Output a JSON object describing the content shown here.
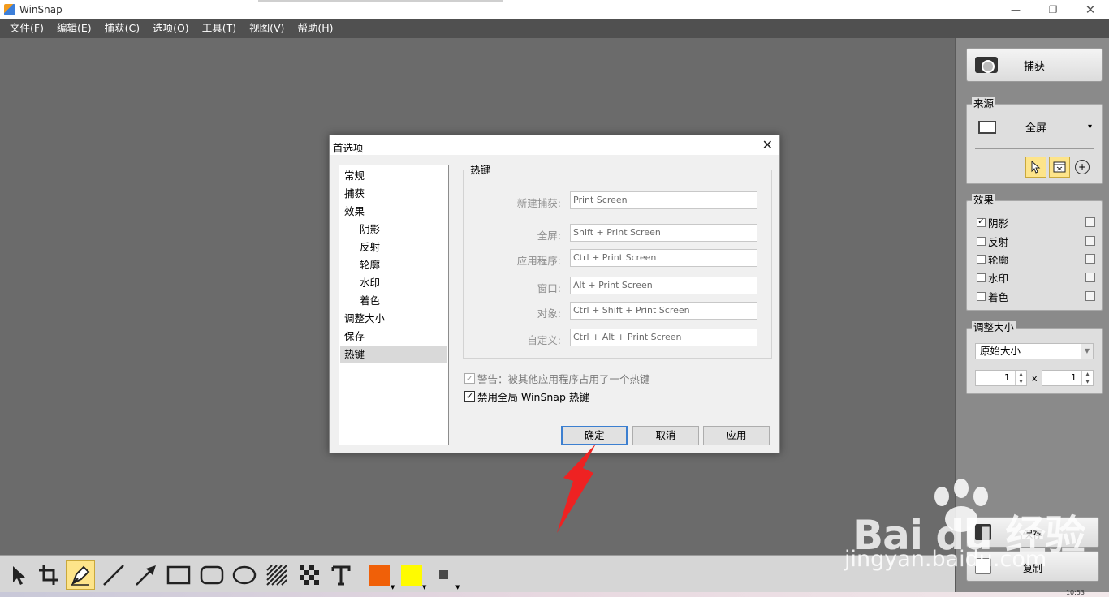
{
  "window": {
    "title": "WinSnap",
    "min_glyph": "—",
    "max_glyph": "❐",
    "close_glyph": "✕"
  },
  "menu": [
    "文件(F)",
    "编辑(E)",
    "捕获(C)",
    "选项(O)",
    "工具(T)",
    "视图(V)",
    "帮助(H)"
  ],
  "right_panel": {
    "capture_label": "捕获",
    "source": {
      "label": "来源",
      "value": "全屏",
      "dropdown_glyph": "▾"
    },
    "effects": {
      "label": "效果",
      "items": [
        {
          "label": "阴影",
          "checked": true
        },
        {
          "label": "反射",
          "checked": false
        },
        {
          "label": "轮廓",
          "checked": false
        },
        {
          "label": "水印",
          "checked": false
        },
        {
          "label": "着色",
          "checked": false
        }
      ]
    },
    "resize": {
      "label": "调整大小",
      "mode": "原始大小",
      "width": "1",
      "height": "1",
      "times": "x"
    },
    "save_label": "保存",
    "copy_label": "复制"
  },
  "toolbar": {
    "tools": [
      "pointer",
      "crop",
      "pen",
      "line",
      "arrow",
      "rectangle",
      "rounded-rectangle",
      "ellipse",
      "hatch",
      "checker",
      "text"
    ],
    "selected_tool": "pen",
    "color_primary": "#f06008",
    "color_secondary": "#fffb00"
  },
  "dialog": {
    "title": "首选项",
    "close_glyph": "✕",
    "nav": [
      {
        "label": "常规",
        "sub": false,
        "selected": false
      },
      {
        "label": "捕获",
        "sub": false,
        "selected": false
      },
      {
        "label": "效果",
        "sub": false,
        "selected": false
      },
      {
        "label": "阴影",
        "sub": true,
        "selected": false
      },
      {
        "label": "反射",
        "sub": true,
        "selected": false
      },
      {
        "label": "轮廓",
        "sub": true,
        "selected": false
      },
      {
        "label": "水印",
        "sub": true,
        "selected": false
      },
      {
        "label": "着色",
        "sub": true,
        "selected": false
      },
      {
        "label": "调整大小",
        "sub": false,
        "selected": false
      },
      {
        "label": "保存",
        "sub": false,
        "selected": false
      },
      {
        "label": "热键",
        "sub": false,
        "selected": true
      }
    ],
    "hotkeys": {
      "group_label": "热键",
      "rows": [
        {
          "label": "新建捕获:",
          "value": "Print Screen"
        },
        {
          "label": "全屏:",
          "value": "Shift + Print Screen"
        },
        {
          "label": "应用程序:",
          "value": "Ctrl + Print Screen"
        },
        {
          "label": "窗口:",
          "value": "Alt + Print Screen"
        },
        {
          "label": "对象:",
          "value": "Ctrl + Shift + Print Screen"
        },
        {
          "label": "自定义:",
          "value": "Ctrl + Alt + Print Screen"
        }
      ]
    },
    "warn_label": "警告：被其他应用程序占用了一个热键",
    "warn_checked": true,
    "disable_label": "禁用全局 WinSnap 热键",
    "disable_checked": true,
    "ok_label": "确定",
    "cancel_label": "取消",
    "apply_label": "应用"
  },
  "watermark": {
    "brand": "Bai du 经验",
    "url": "jingyan.baidu.com"
  },
  "clock_fragment": "10:53",
  "check_glyph": "✓",
  "colors": {
    "menubar": "#505050",
    "canvas": "#6b6b6b",
    "highlight": "#fde48a",
    "annotation_arrow": "#ee2222",
    "ok_border": "#3c7fd0"
  }
}
